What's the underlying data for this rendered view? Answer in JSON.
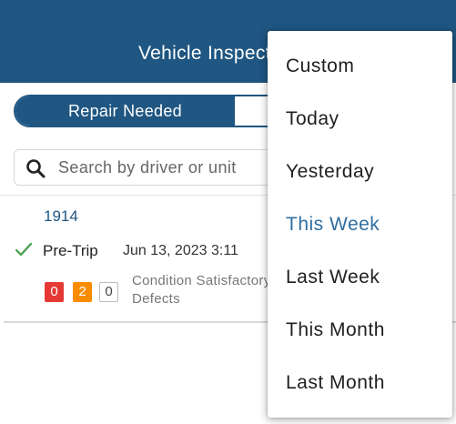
{
  "header": {
    "title": "Vehicle Inspections"
  },
  "segment": {
    "active_label": "Repair Needed",
    "inactive_label": ""
  },
  "search": {
    "placeholder": "Search by driver or unit"
  },
  "record": {
    "vehicle_id": "1914",
    "trip_type": "Pre-Trip",
    "datetime": "Jun 13, 2023 3:11",
    "badges": [
      "0",
      "2",
      "0"
    ],
    "condition_line1": "Condition Satisfactory",
    "condition_line2": "Defects"
  },
  "dropdown": {
    "items": [
      "Custom",
      "Today",
      "Yesterday",
      "This Week",
      "Last Week",
      "This Month",
      "Last Month"
    ],
    "selected": "This Week"
  },
  "colors": {
    "brand": "#1f5682",
    "selected": "#2f6ea0",
    "badge_red": "#e53935",
    "badge_orange": "#fb8c00",
    "check_green": "#43a047"
  },
  "icons": [
    "search-icon",
    "check-icon"
  ]
}
